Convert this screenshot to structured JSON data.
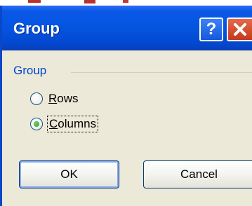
{
  "dialog": {
    "title": "Group",
    "help_button": "?",
    "close_icon": "close-icon"
  },
  "group": {
    "label": "Group",
    "options": [
      {
        "label_prefix": "",
        "label_underlined": "R",
        "label_rest": "ows",
        "selected": false
      },
      {
        "label_prefix": "",
        "label_underlined": "C",
        "label_rest": "olumns",
        "selected": true
      }
    ]
  },
  "buttons": {
    "ok": "OK",
    "cancel": "Cancel"
  },
  "colors": {
    "titlebar": "#0554e0",
    "group_label": "#0046d5",
    "dialog_bg": "#ece9d8"
  }
}
